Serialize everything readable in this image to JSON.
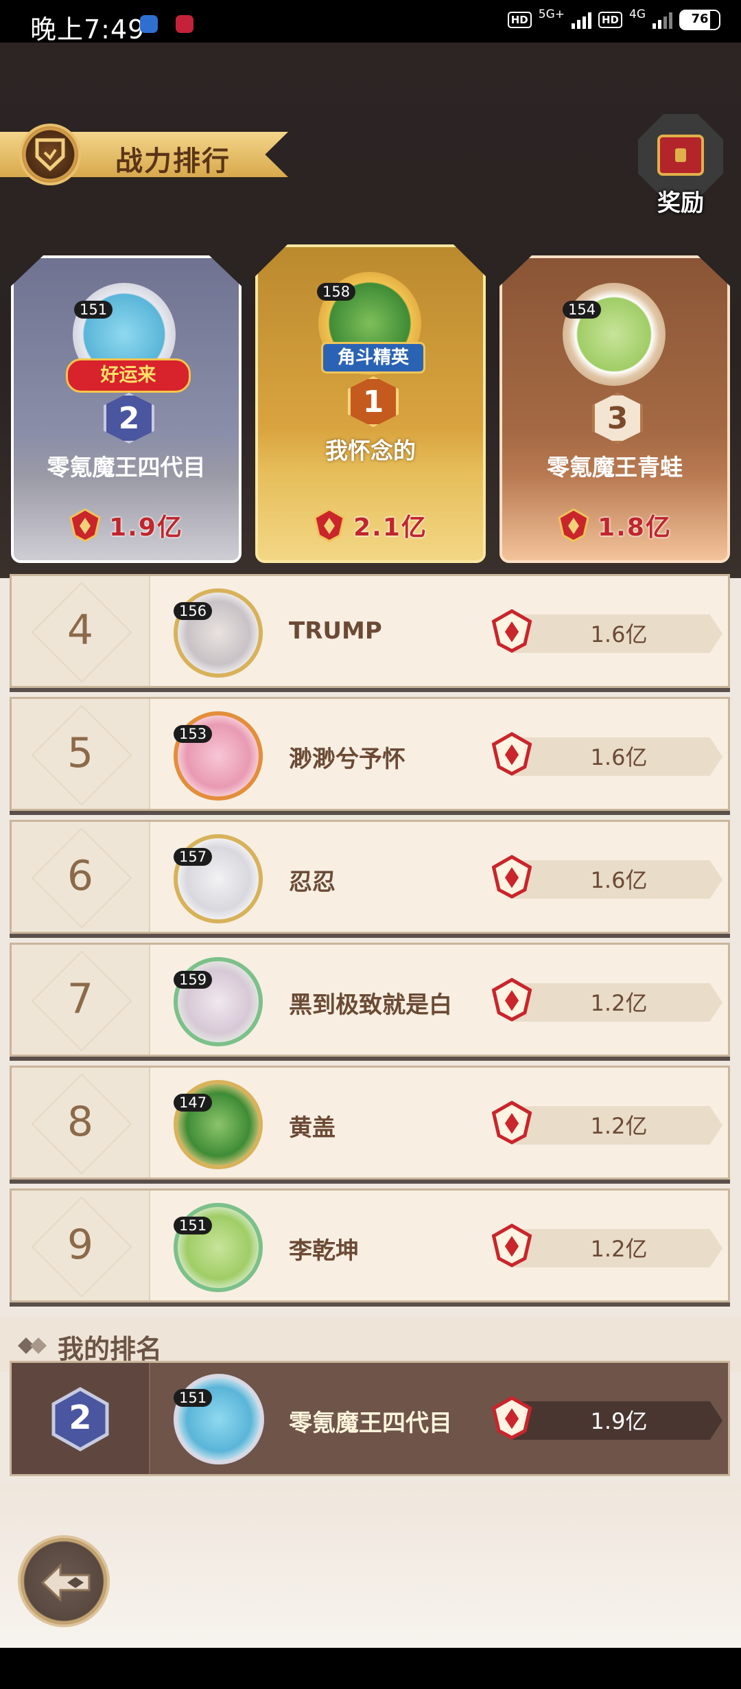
{
  "status_bar": {
    "time": "晚上7:49",
    "hd1": "HD",
    "net1": "5G+",
    "hd2": "HD",
    "net2": "4G",
    "battery": "76"
  },
  "header": {
    "title": "战力排行",
    "reward_label": "奖励"
  },
  "podium": [
    {
      "rank": "2",
      "level": "151",
      "name": "零氪魔王四代目",
      "power": "1.9亿",
      "badge": "好运来"
    },
    {
      "rank": "1",
      "level": "158",
      "name": "我怀念的",
      "power": "2.1亿",
      "badge": "角斗精英"
    },
    {
      "rank": "3",
      "level": "154",
      "name": "零氪魔王青蛙",
      "power": "1.8亿"
    }
  ],
  "list": [
    {
      "rank": "4",
      "level": "156",
      "name": "TRUMP",
      "power": "1.6亿"
    },
    {
      "rank": "5",
      "level": "153",
      "name": "渺渺兮予怀",
      "power": "1.6亿"
    },
    {
      "rank": "6",
      "level": "157",
      "name": "忍忍",
      "power": "1.6亿"
    },
    {
      "rank": "7",
      "level": "159",
      "name": "黑到极致就是白",
      "power": "1.2亿"
    },
    {
      "rank": "8",
      "level": "147",
      "name": "黄盖",
      "power": "1.2亿"
    },
    {
      "rank": "9",
      "level": "151",
      "name": "李乾坤",
      "power": "1.2亿"
    }
  ],
  "my_rank": {
    "section_title": "我的排名",
    "rank": "2",
    "level": "151",
    "name": "零氪魔王四代目",
    "power": "1.9亿"
  }
}
